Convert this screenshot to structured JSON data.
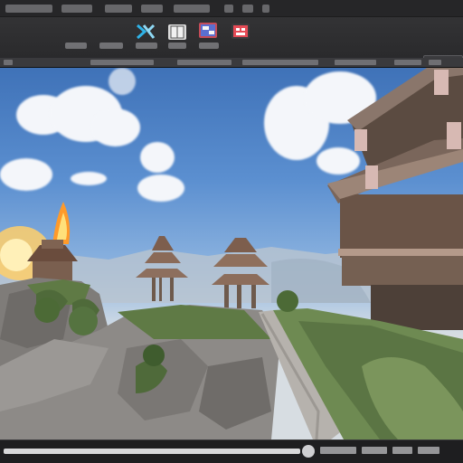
{
  "scene": {
    "colors": {
      "sky_top": "#3f72b8",
      "sky_horizon": "#c8d6e4",
      "castle_wall": "#6b5a4e",
      "castle_trim": "#d7b9b3",
      "grass": "#5f7a45",
      "rock": "#8d8a87",
      "fire": "#ffb23a"
    }
  },
  "icons": {
    "toolbar_1": "x-logo-icon",
    "toolbar_2": "book-icon",
    "toolbar_3": "blueprint-icon",
    "toolbar_4": "grid-icon",
    "status": "play-icon"
  }
}
